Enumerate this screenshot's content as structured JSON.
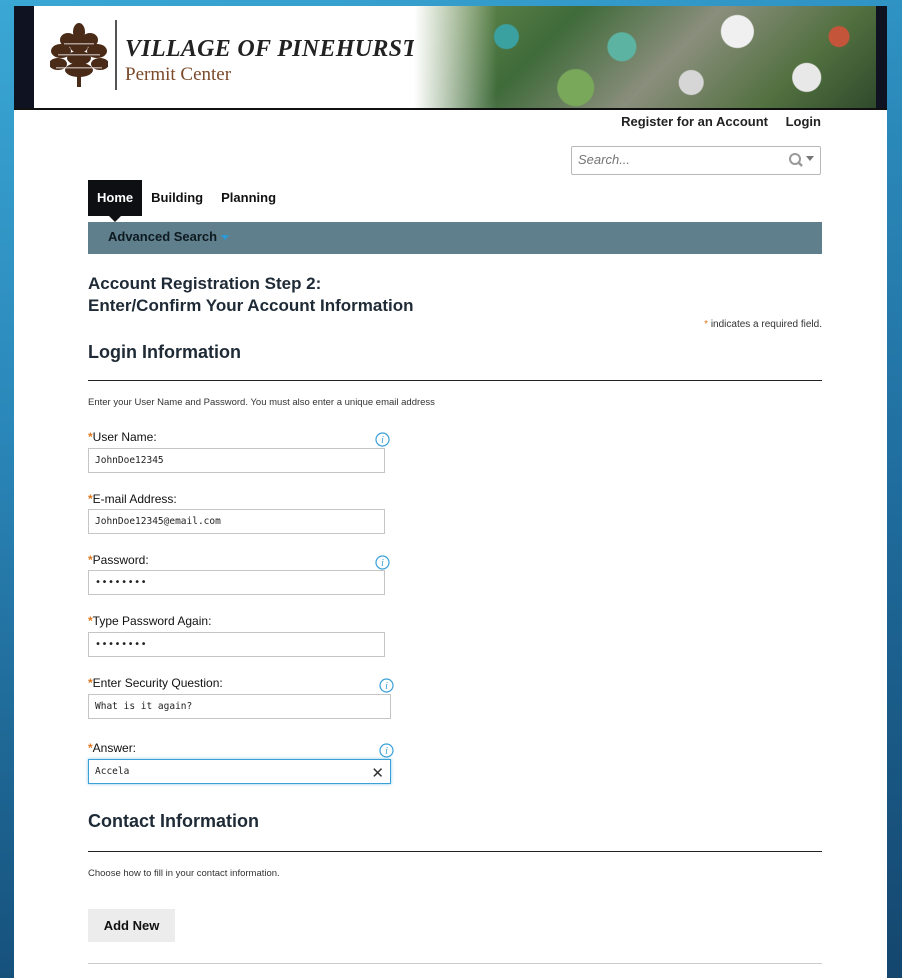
{
  "brand": {
    "title": "VILLAGE OF PINEHURST",
    "subtitle": "Permit Center"
  },
  "top_links": {
    "register": "Register for an Account",
    "login": "Login"
  },
  "search": {
    "placeholder": "Search..."
  },
  "nav": {
    "tabs": [
      {
        "label": "Home",
        "active": true
      },
      {
        "label": "Building",
        "active": false
      },
      {
        "label": "Planning",
        "active": false
      }
    ],
    "sub": {
      "label": "Advanced Search"
    }
  },
  "page": {
    "title_line1": "Account Registration Step 2:",
    "title_line2": "Enter/Confirm Your Account Information",
    "required_star": "*",
    "required_note": "indicates a required field."
  },
  "login_section": {
    "heading": "Login Information",
    "hint": "Enter your User Name and Password.  You must also enter a unique email address",
    "fields": [
      {
        "label": "User Name:",
        "value": "JohnDoe12345"
      },
      {
        "label": "E-mail Address:",
        "value": "JohnDoe12345@email.com"
      },
      {
        "label": "Password:",
        "value": "••••••••"
      },
      {
        "label": "Type Password Again:",
        "value": "••••••••"
      },
      {
        "label": "Enter Security Question:",
        "value": "What is it again?"
      },
      {
        "label": "Answer:",
        "value": "Accela"
      }
    ]
  },
  "contact_section": {
    "heading": "Contact Information",
    "hint": "Choose how to fill in your contact information.",
    "add_button": "Add New"
  },
  "colors": {
    "accent_blue": "#3aa0d8",
    "required_orange": "#e07820",
    "subnav_bg": "#5f7f8d",
    "nav_active_bg": "#0e0f12"
  }
}
